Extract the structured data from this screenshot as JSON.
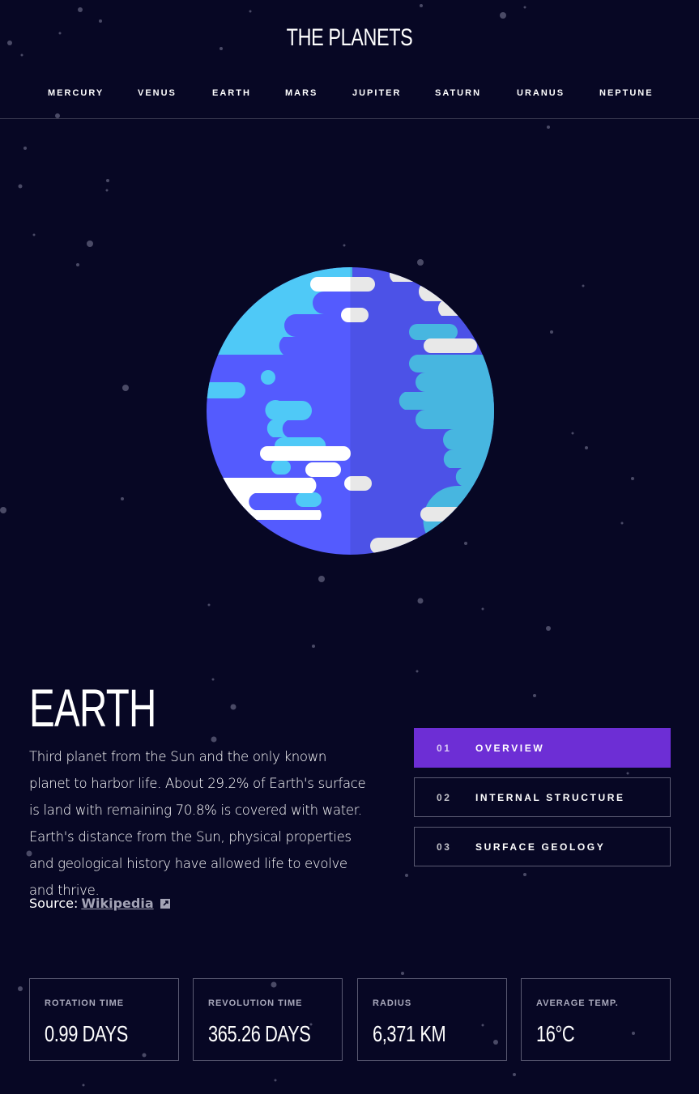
{
  "header": {
    "logo": "THE PLANETS",
    "nav": [
      "MERCURY",
      "VENUS",
      "EARTH",
      "MARS",
      "JUPITER",
      "SATURN",
      "URANUS",
      "NEPTUNE"
    ]
  },
  "planet": {
    "name": "EARTH",
    "description": "Third planet from the Sun and the only known planet to harbor life. About 29.2% of Earth's surface is land with remaining 70.8% is covered with water. Earth's distance from the Sun, physical properties and geological history have allowed life to evolve and thrive.",
    "source_label": "Source:",
    "source_link": "Wikipedia",
    "image_icon": "earth-planet-illustration"
  },
  "tabs": [
    {
      "num": "01",
      "label": "OVERVIEW",
      "active": true
    },
    {
      "num": "02",
      "label": "INTERNAL STRUCTURE",
      "active": false
    },
    {
      "num": "03",
      "label": "SURFACE GEOLOGY",
      "active": false
    }
  ],
  "stats": [
    {
      "label": "ROTATION TIME",
      "value": "0.99 DAYS"
    },
    {
      "label": "REVOLUTION TIME",
      "value": "365.26 DAYS"
    },
    {
      "label": "RADIUS",
      "value": "6,371 KM"
    },
    {
      "label": "AVERAGE TEMP.",
      "value": "16°C"
    }
  ],
  "colors": {
    "background": "#070724",
    "accent": "#6d2ed5",
    "border": "#5a5a72",
    "ocean": "#545bfe",
    "land": "#4fc9f7",
    "cloud": "#ffffff"
  }
}
